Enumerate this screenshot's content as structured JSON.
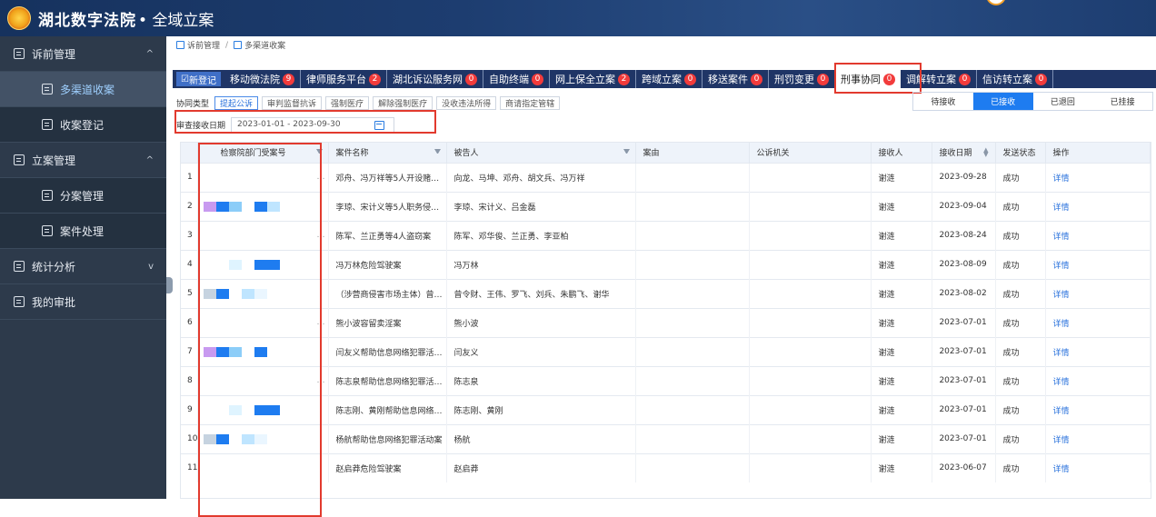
{
  "header": {
    "title": "湖北数字法院",
    "subtitle": "• 全域立案"
  },
  "sidebar": {
    "items": [
      {
        "label": "诉前管理",
        "type": "group",
        "arrow": "^"
      },
      {
        "label": "多渠道收案",
        "type": "sub",
        "active": true
      },
      {
        "label": "收案登记",
        "type": "sub"
      },
      {
        "label": "立案管理",
        "type": "group",
        "arrow": "^"
      },
      {
        "label": "分案管理",
        "type": "sub"
      },
      {
        "label": "案件处理",
        "type": "sub"
      },
      {
        "label": "统计分析",
        "type": "group",
        "arrow": "v"
      },
      {
        "label": "我的审批",
        "type": "group"
      }
    ]
  },
  "breadcrumb": {
    "root": "诉前管理",
    "sep": "/",
    "current": "多渠道收案"
  },
  "tabs": [
    {
      "label": "新登记"
    },
    {
      "label": "移动微法院",
      "badge": "9"
    },
    {
      "label": "律师服务平台",
      "badge": "2"
    },
    {
      "label": "湖北诉讼服务网",
      "badge": "0"
    },
    {
      "label": "自助终端",
      "badge": "0"
    },
    {
      "label": "网上保全立案",
      "badge": "2"
    },
    {
      "label": "跨域立案",
      "badge": "0"
    },
    {
      "label": "移送案件",
      "badge": "0"
    },
    {
      "label": "刑罚变更",
      "badge": "0"
    },
    {
      "label": "刑事协同",
      "badge": "0"
    },
    {
      "label": "调解转立案",
      "badge": "0"
    },
    {
      "label": "信访转立案",
      "badge": "0"
    }
  ],
  "coop": {
    "label": "协同类型",
    "types": [
      "提起公诉",
      "审判监督抗诉",
      "强制医疗",
      "解除强制医疗",
      "没收违法所得",
      "商请指定管辖"
    ]
  },
  "status_tabs": [
    "待接收",
    "已接收",
    "已退回",
    "已挂接"
  ],
  "filter": {
    "label": "审查接收日期",
    "value": "2023-01-01 - 2023-09-30"
  },
  "table": {
    "columns": [
      "",
      "检察院部门受案号",
      "案件名称",
      "被告人",
      "案由",
      "公诉机关",
      "接收人",
      "接收日期",
      "发送状态",
      "操作"
    ],
    "rows": [
      {
        "no": "1",
        "case_no": "…",
        "name": "邓舟、冯万祥等5人开设赌…",
        "defendants": "向龙、马坤、邓舟、胡文兵、冯万祥",
        "cause": "",
        "organ": "",
        "receiver": "谢涟",
        "date": "2023-09-28",
        "status": "成功",
        "op": "详情"
      },
      {
        "no": "2",
        "case_no": "",
        "name": "李琼、宋计义等5人职务侵…",
        "defendants": "李琼、宋计义、吕金磊",
        "cause": "",
        "organ": "",
        "receiver": "谢涟",
        "date": "2023-09-04",
        "status": "成功",
        "op": "详情"
      },
      {
        "no": "3",
        "case_no": "…",
        "name": "陈军、兰正勇等4人盗窃案",
        "defendants": "陈军、邓华俊、兰正勇、李亚柏",
        "cause": "",
        "organ": "",
        "receiver": "谢涟",
        "date": "2023-08-24",
        "status": "成功",
        "op": "详情"
      },
      {
        "no": "4",
        "case_no": "…",
        "name": "冯万林危险驾驶案",
        "defendants": "冯万林",
        "cause": "",
        "organ": "",
        "receiver": "谢涟",
        "date": "2023-08-09",
        "status": "成功",
        "op": "详情"
      },
      {
        "no": "5",
        "case_no": "…",
        "name": "（涉营商侵害市场主体）曾…",
        "defendants": "曾令财、王伟、罗飞、刘兵、朱鹏飞、谢华",
        "cause": "",
        "organ": "",
        "receiver": "谢涟",
        "date": "2023-08-02",
        "status": "成功",
        "op": "详情"
      },
      {
        "no": "6",
        "case_no": "…",
        "name": "熊小波容留卖淫案",
        "defendants": "熊小波",
        "cause": "",
        "organ": "",
        "receiver": "谢涟",
        "date": "2023-07-01",
        "status": "成功",
        "op": "详情"
      },
      {
        "no": "7",
        "case_no": "…",
        "name": "闫友义帮助信息网络犯罪活…",
        "defendants": "闫友义",
        "cause": "",
        "organ": "",
        "receiver": "谢涟",
        "date": "2023-07-01",
        "status": "成功",
        "op": "详情"
      },
      {
        "no": "8",
        "case_no": "…",
        "name": "陈志泉帮助信息网络犯罪活…",
        "defendants": "陈志泉",
        "cause": "",
        "organ": "",
        "receiver": "谢涟",
        "date": "2023-07-01",
        "status": "成功",
        "op": "详情"
      },
      {
        "no": "9",
        "case_no": "…",
        "name": "陈志刚、黄刚帮助信息网络…",
        "defendants": "陈志刚、黄刚",
        "cause": "",
        "organ": "",
        "receiver": "谢涟",
        "date": "2023-07-01",
        "status": "成功",
        "op": "详情"
      },
      {
        "no": "10",
        "case_no": "…",
        "name": "杨航帮助信息网络犯罪活动案",
        "defendants": "杨航",
        "cause": "",
        "organ": "",
        "receiver": "谢涟",
        "date": "2023-07-01",
        "status": "成功",
        "op": "详情"
      },
      {
        "no": "11",
        "case_no": "",
        "name": "赵启莽危险驾驶案",
        "defendants": "赵启莽",
        "cause": "",
        "organ": "",
        "receiver": "谢涟",
        "date": "2023-06-07",
        "status": "成功",
        "op": "详情"
      }
    ]
  },
  "colors": {
    "topbar": "#1d3d70",
    "sidebar": "#2d3a4b",
    "tabbar": "#1f3566",
    "accent": "#1e7cf0",
    "highlight": "#e23a2e",
    "badge": "#f23b3b"
  }
}
